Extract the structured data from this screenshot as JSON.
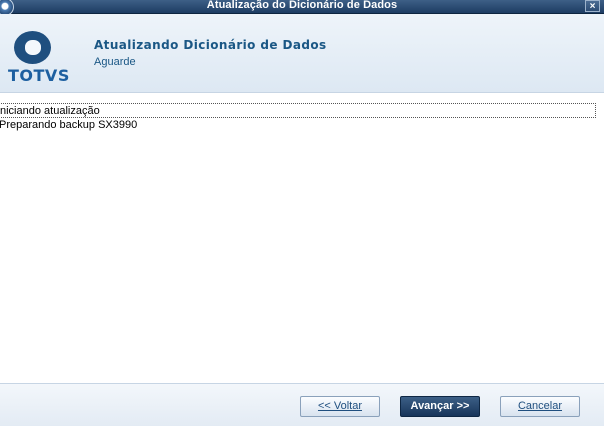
{
  "window": {
    "title": "Atualização do Dicionário de Dados",
    "close_symbol": "×"
  },
  "header": {
    "logo_text": "TOTVS",
    "title": "Atualizando Dicionário de Dados",
    "subtitle": "Aguarde"
  },
  "log": {
    "lines": [
      "niciando atualização",
      "Preparando backup SX3990"
    ]
  },
  "buttons": {
    "back": "<< Voltar",
    "next": "Avançar >>",
    "cancel": "Cancelar"
  },
  "icons": {
    "app": "app-globe-icon",
    "close": "close-icon",
    "logo": "totvs-logo-icon"
  }
}
